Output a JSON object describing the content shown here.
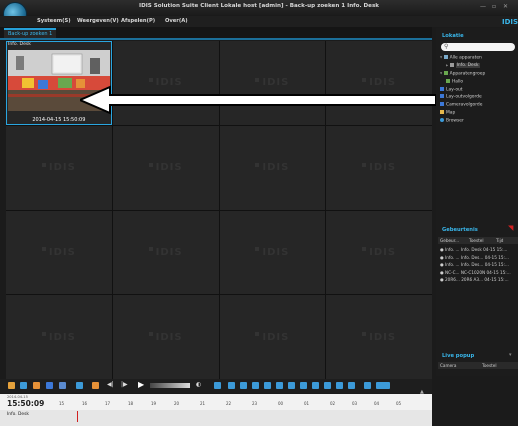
{
  "window": {
    "title": "IDIS Solution Suite Client Lokale host [admin] - Back-up zoeken 1  Info. Desk",
    "brand": "IDIS"
  },
  "menu": [
    "Systeem(S)",
    "Weergeven(V)",
    "Afspelen(P)",
    "Over(A)"
  ],
  "tabs": [
    {
      "label": "Back-up zoeken 1",
      "active": true
    }
  ],
  "grid": {
    "watermark": "IDIS",
    "active_camera": {
      "label": "Info. Desk",
      "timestamp": "2014-04-15 15:50:09"
    }
  },
  "locatie": {
    "header": "Lokatie",
    "search_placeholder": "",
    "tree": [
      {
        "label": "Alle apparaten",
        "icon": "devices-icon"
      },
      {
        "label": "Info. Desk",
        "icon": "camera-icon",
        "selected": true
      },
      {
        "label": "Apparatengroep",
        "icon": "group-icon"
      },
      {
        "label": "Hallo",
        "icon": "monitor-icon"
      },
      {
        "label": "Lay-out",
        "icon": "layout-icon"
      },
      {
        "label": "Lay-outvolgorde",
        "icon": "layout-sequence-icon"
      },
      {
        "label": "Cameravolgorde",
        "icon": "camera-sequence-icon"
      },
      {
        "label": "Map",
        "icon": "map-icon"
      },
      {
        "label": "Browser",
        "icon": "browser-icon"
      }
    ]
  },
  "events": {
    "header": "Gebeurtenis",
    "columns": [
      "Gebeur...",
      "Toestel",
      "Tijd"
    ],
    "rows": [
      [
        "Info. ...",
        "Info. Desk",
        "04-15 15:..."
      ],
      [
        "Info. ...",
        "Info. Des...",
        "04-15 15:..."
      ],
      [
        "Info. ...",
        "Info. Des...",
        "04-15 15:..."
      ],
      [
        "NC-C...",
        "NC-C1020N",
        "04-15 15:..."
      ],
      [
        "20R6...",
        "20R6 A3...",
        "04-15 15:..."
      ]
    ]
  },
  "live_popup": {
    "header": "Live popup",
    "columns": [
      "Camera",
      "Toestel"
    ]
  },
  "timeline": {
    "date": "2014-04-15",
    "time": "15:50:09",
    "hours": [
      "15",
      "16",
      "17",
      "18",
      "19",
      "20",
      "21",
      "22",
      "23",
      "00",
      "01",
      "02",
      "03",
      "04",
      "05"
    ],
    "row_label": "Info. Desk"
  },
  "colors": {
    "accent": "#26a0d8",
    "background": "#1b1b1b"
  }
}
